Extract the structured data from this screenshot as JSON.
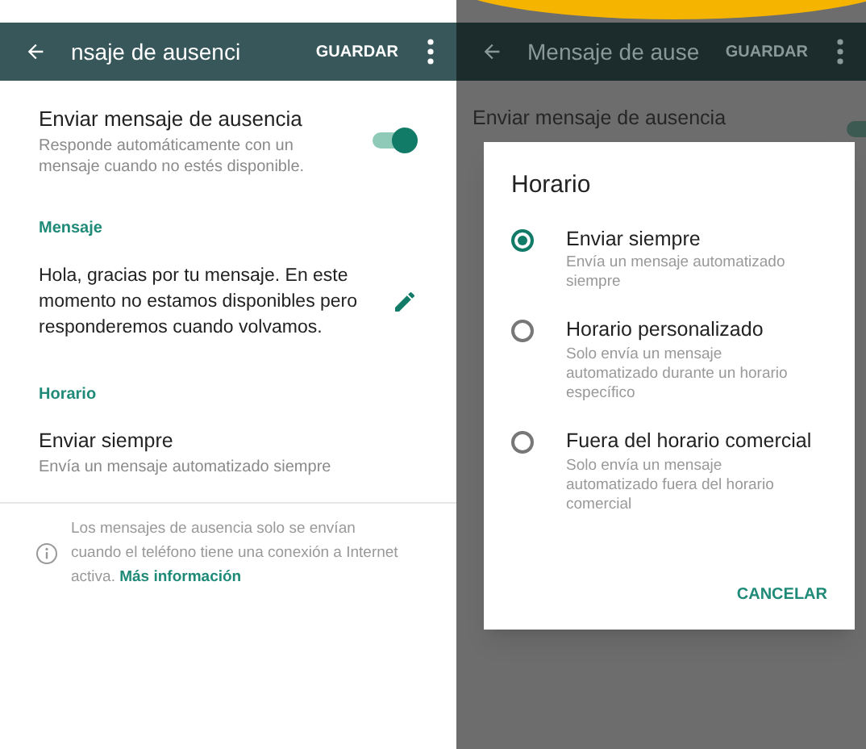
{
  "main_screen": {
    "app_bar": {
      "title": "nsaje de ausenci",
      "action": "GUARDAR"
    },
    "auto_reply": {
      "title": "Enviar mensaje de ausencia",
      "subtitle": "Responde automáticamente con un mensaje cuando no estés disponible.",
      "on": true
    },
    "message_section": {
      "header": "Mensaje",
      "text": "Hola, gracias por tu mensaje. En este momento no estamos disponibles pero responderemos cuando volvamos."
    },
    "schedule_section": {
      "header": "Horario",
      "title": "Enviar siempre",
      "subtitle": "Envía un mensaje automatizado siempre"
    },
    "info": {
      "text": "Los mensajes de ausencia solo se envían cuando el teléfono tiene una conexión a Internet activa.",
      "link": "Más información"
    }
  },
  "dimmed_screen": {
    "app_bar": {
      "title": "Mensaje de ause",
      "action": "GUARDAR"
    },
    "auto_reply": {
      "title": "Enviar mensaje de ausencia",
      "on": true
    }
  },
  "dialog": {
    "title": "Horario",
    "options": [
      {
        "label": "Enviar siempre",
        "description": "Envía un mensaje automatizado siempre",
        "selected": true
      },
      {
        "label": "Horario personalizado",
        "description": "Solo envía un mensaje automatizado durante un horario específico",
        "selected": false
      },
      {
        "label": "Fuera del horario comercial",
        "description": "Solo envía un mensaje automatizado fuera del horario comercial",
        "selected": false
      }
    ],
    "cancel": "CANCELAR"
  }
}
